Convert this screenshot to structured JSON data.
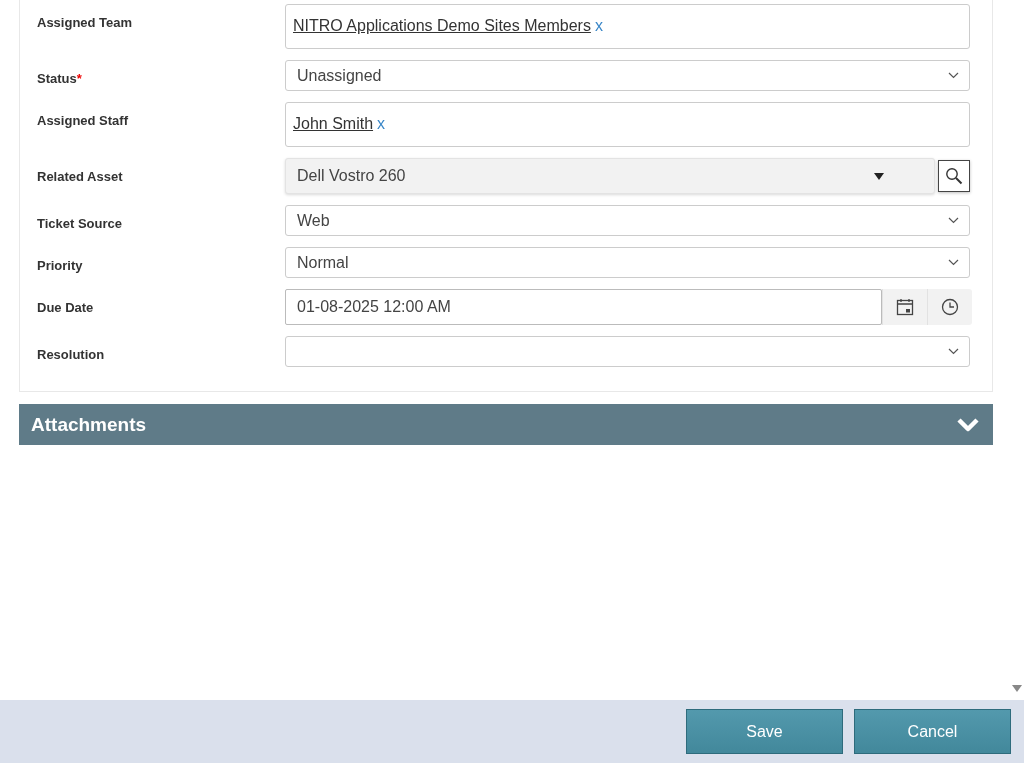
{
  "form": {
    "fields": [
      {
        "label": "Assigned Team",
        "kind": "people",
        "tags": [
          "NITRO Applications Demo Sites Members"
        ],
        "remove": "x"
      },
      {
        "label": "Status",
        "required_mark": "*",
        "kind": "select",
        "value": "Unassigned"
      },
      {
        "label": "Assigned Staff",
        "kind": "people",
        "tags": [
          "John Smith"
        ],
        "remove": "x"
      },
      {
        "label": "Related Asset",
        "kind": "lookup",
        "value": "Dell Vostro 260"
      },
      {
        "label": "Ticket Source",
        "kind": "select",
        "value": "Web"
      },
      {
        "label": "Priority",
        "kind": "select",
        "value": "Normal"
      },
      {
        "label": "Due Date",
        "kind": "datetime",
        "value": "01-08-2025 12:00 AM"
      },
      {
        "label": "Resolution",
        "kind": "select"
      }
    ]
  },
  "section": {
    "title": "Attachments"
  },
  "buttons": [
    "Save",
    "Cancel"
  ]
}
